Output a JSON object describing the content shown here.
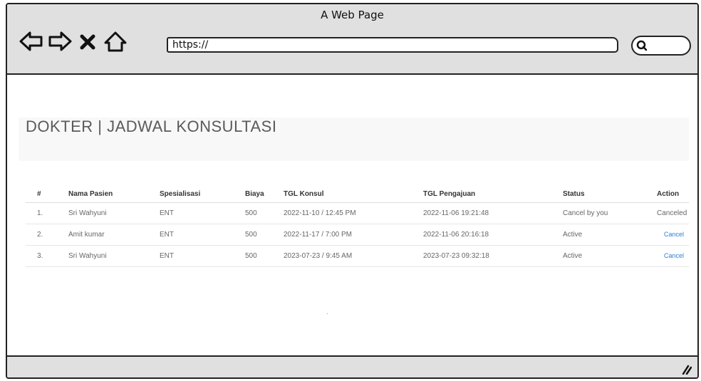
{
  "window": {
    "title": "A Web Page"
  },
  "toolbar": {
    "back_icon": "back-arrow-icon",
    "forward_icon": "forward-arrow-icon",
    "stop_icon": "close-icon",
    "home_icon": "home-icon",
    "url": "https://",
    "search_icon": "search-icon"
  },
  "page": {
    "title": "DOKTER | JADWAL KONSULTASI"
  },
  "table": {
    "headers": [
      "#",
      "Nama Pasien",
      "Spesialisasi",
      "Biaya",
      "TGL Konsul",
      "TGL Pengajuan",
      "Status",
      "Action"
    ],
    "rows": [
      {
        "no": "1.",
        "name": "Sri Wahyuni",
        "spec": "ENT",
        "cost": "500",
        "konsul": "2022-11-10 / 12:45 PM",
        "pengajuan": "2022-11-06 19:21:48",
        "status": "Cancel by you",
        "action": "Canceled"
      },
      {
        "no": "2.",
        "name": "Amit kumar",
        "spec": "ENT",
        "cost": "500",
        "konsul": "2022-11-17 / 7:00 PM",
        "pengajuan": "2022-11-06 20:16:18",
        "status": "Active",
        "action": "Cancel"
      },
      {
        "no": "3.",
        "name": "Sri Wahyuni",
        "spec": "ENT",
        "cost": "500",
        "konsul": "2023-07-23 / 9:45 AM",
        "pengajuan": "2023-07-23 09:32:18",
        "status": "Active",
        "action": "Cancel"
      }
    ]
  },
  "colors": {
    "link": "#2a7fd4",
    "chrome": "#e0e0e0",
    "header_bg": "#f8f8f8"
  }
}
